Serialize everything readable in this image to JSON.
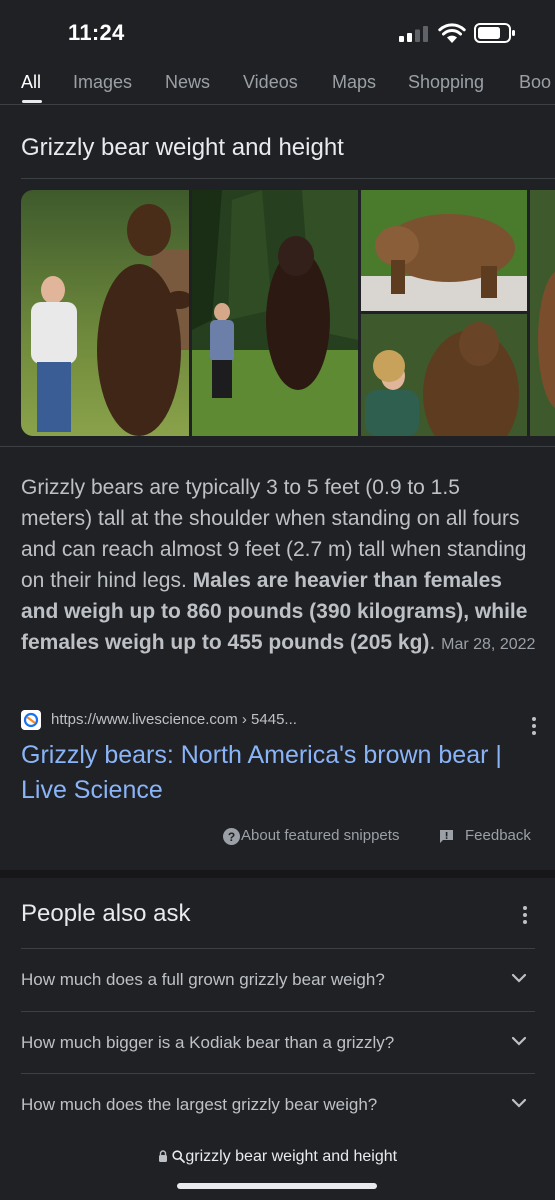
{
  "status_bar": {
    "time": "11:24"
  },
  "tabs": [
    {
      "label": "All",
      "active": true
    },
    {
      "label": "Images"
    },
    {
      "label": "News"
    },
    {
      "label": "Videos"
    },
    {
      "label": "Maps"
    },
    {
      "label": "Shopping"
    },
    {
      "label": "Boo"
    }
  ],
  "query_title": "Grizzly bear weight and height",
  "snippet": {
    "text_plain": "Grizzly bears are typically 3 to 5 feet (0.9 to 1.5 meters) tall at the shoulder when standing on all fours and can reach almost 9 feet (2.7 m) tall when standing on their hind legs. ",
    "text_bold": "Males are heavier than females and weigh up to 860 pounds (390 kilograms), while females weigh up to 455 pounds (205 kg)",
    "text_end": ".",
    "date": "Mar 28, 2022"
  },
  "source": {
    "url": "https://www.livescience.com › 5445...",
    "title": "Grizzly bears: North America's brown bear | Live Science"
  },
  "snippet_footer": {
    "about": "About featured snippets",
    "feedback": "Feedback"
  },
  "people_also_ask": {
    "title": "People also ask",
    "questions": [
      "How much does a full grown grizzly bear weigh?",
      "How much bigger is a Kodiak bear than a grizzly?",
      "How much does the largest grizzly bear weigh?"
    ]
  },
  "bottom_bar": {
    "query": "grizzly bear weight and height"
  },
  "colors": {
    "background": "#202124",
    "link": "#8ab4f8",
    "text": "#bdc1c6"
  }
}
